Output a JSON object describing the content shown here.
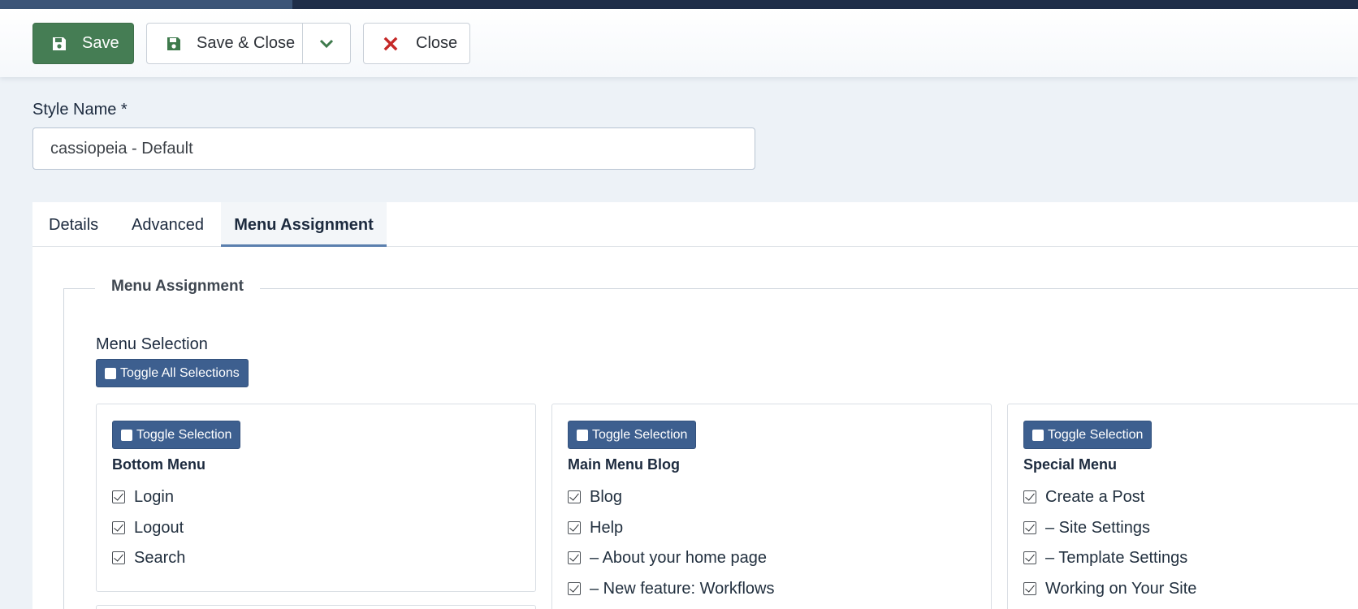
{
  "toolbar": {
    "save_label": "Save",
    "save_close_label": "Save & Close",
    "close_label": "Close"
  },
  "form": {
    "style_name_label": "Style Name *",
    "style_name_value": "cassiopeia - Default"
  },
  "tabs": [
    {
      "label": "Details",
      "active": false
    },
    {
      "label": "Advanced",
      "active": false
    },
    {
      "label": "Menu Assignment",
      "active": true
    }
  ],
  "menu_assignment": {
    "legend": "Menu Assignment",
    "selection_label": "Menu Selection",
    "toggle_all_label": "Toggle All Selections",
    "toggle_label": "Toggle Selection",
    "menus": [
      {
        "title": "Bottom Menu",
        "items": [
          {
            "label": "Login",
            "checked": true
          },
          {
            "label": "Logout",
            "checked": true
          },
          {
            "label": "Search",
            "checked": true
          }
        ]
      },
      {
        "title": "Main Menu Blog",
        "items": [
          {
            "label": "Blog",
            "checked": true
          },
          {
            "label": "Help",
            "checked": true
          },
          {
            "label": "– About your home page",
            "checked": true
          },
          {
            "label": "– New feature: Workflows",
            "checked": true
          }
        ]
      },
      {
        "title": "Special Menu",
        "items": [
          {
            "label": "Create a Post",
            "checked": true
          },
          {
            "label": "– Site Settings",
            "checked": true
          },
          {
            "label": "– Template Settings",
            "checked": true
          },
          {
            "label": "Working on Your Site",
            "checked": true
          }
        ]
      }
    ]
  },
  "colors": {
    "save_green": "#457d54",
    "toggle_blue": "#3d5f8f",
    "close_red": "#c52827",
    "page_bg": "#edf2f7"
  }
}
